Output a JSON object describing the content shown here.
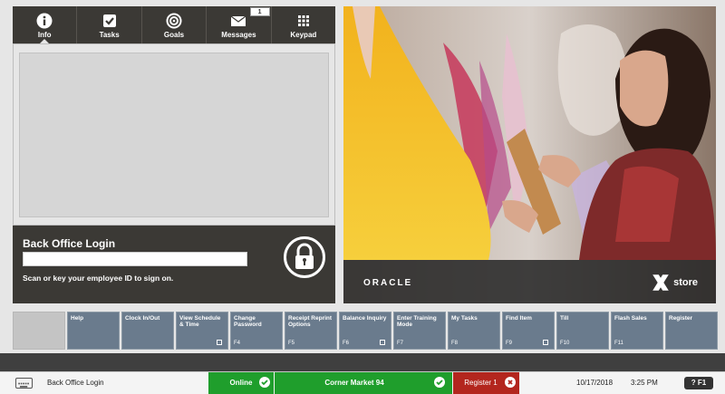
{
  "tabs": [
    {
      "label": "Info",
      "icon": "info-icon"
    },
    {
      "label": "Tasks",
      "icon": "checkbox-icon"
    },
    {
      "label": "Goals",
      "icon": "target-icon"
    },
    {
      "label": "Messages",
      "icon": "envelope-icon",
      "badge": "1"
    },
    {
      "label": "Keypad",
      "icon": "keypad-icon"
    }
  ],
  "login": {
    "title": "Back Office Login",
    "input_value": "",
    "hint": "Scan or key your employee ID to sign on."
  },
  "hero": {
    "oracle": "ORACLE",
    "xstore": "store"
  },
  "fkeys": [
    {
      "label": "",
      "fkey": ""
    },
    {
      "label": "Help",
      "fkey": ""
    },
    {
      "label": "Clock In/Out",
      "fkey": ""
    },
    {
      "label": "View Schedule & Time",
      "fkey": ""
    },
    {
      "label": "Change Password",
      "fkey": "F4"
    },
    {
      "label": "Receipt Reprint Options",
      "fkey": "F5"
    },
    {
      "label": "Balance Inquiry",
      "fkey": "F6"
    },
    {
      "label": "Enter Training Mode",
      "fkey": "F7"
    },
    {
      "label": "My Tasks",
      "fkey": "F8"
    },
    {
      "label": "Find Item",
      "fkey": "F9"
    },
    {
      "label": "Till",
      "fkey": "F10"
    },
    {
      "label": "Flash Sales",
      "fkey": "F11"
    },
    {
      "label": "Register",
      "fkey": ""
    }
  ],
  "status": {
    "screen": "Back Office Login",
    "online": "Online",
    "store": "Corner Market 94",
    "register": "Register 1",
    "date": "10/17/2018",
    "time": "3:25 PM",
    "help": "F1",
    "online_color": "#1f9e2c",
    "register_color": "#b3261e"
  }
}
